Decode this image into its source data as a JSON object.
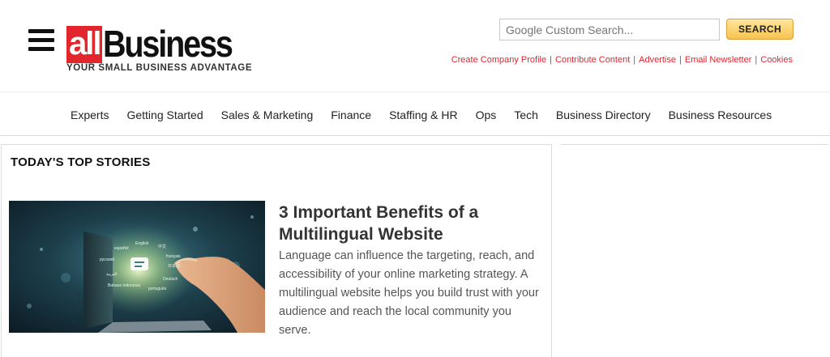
{
  "header": {
    "logo_all": "all",
    "logo_business": "Business",
    "tagline": "YOUR SMALL BUSINESS ADVANTAGE",
    "search_placeholder": "Google Custom Search...",
    "search_button": "SEARCH",
    "utility_links": [
      "Create Company Profile",
      "Contribute Content",
      "Advertise",
      "Email Newsletter",
      "Cookies"
    ],
    "accent_color": "#e3262e"
  },
  "nav": {
    "items": [
      "Experts",
      "Getting Started",
      "Sales & Marketing",
      "Finance",
      "Staffing & HR",
      "Ops",
      "Tech",
      "Business Directory",
      "Business Resources"
    ]
  },
  "main": {
    "section_title": "TODAY'S TOP STORIES",
    "story": {
      "title": "3 Important Benefits of a Multilingual Website",
      "excerpt": "Language can influence the targeting, reach, and accessibility of your online marketing strategy. A multilingual website helps you build trust with your audience and reach the local community you serve.",
      "image_words": [
        "English",
        "español",
        "中文",
        "français",
        "русский",
        "العربية",
        "日本語",
        "Deutsch",
        "Bahasa Indonesia",
        "português"
      ]
    }
  }
}
